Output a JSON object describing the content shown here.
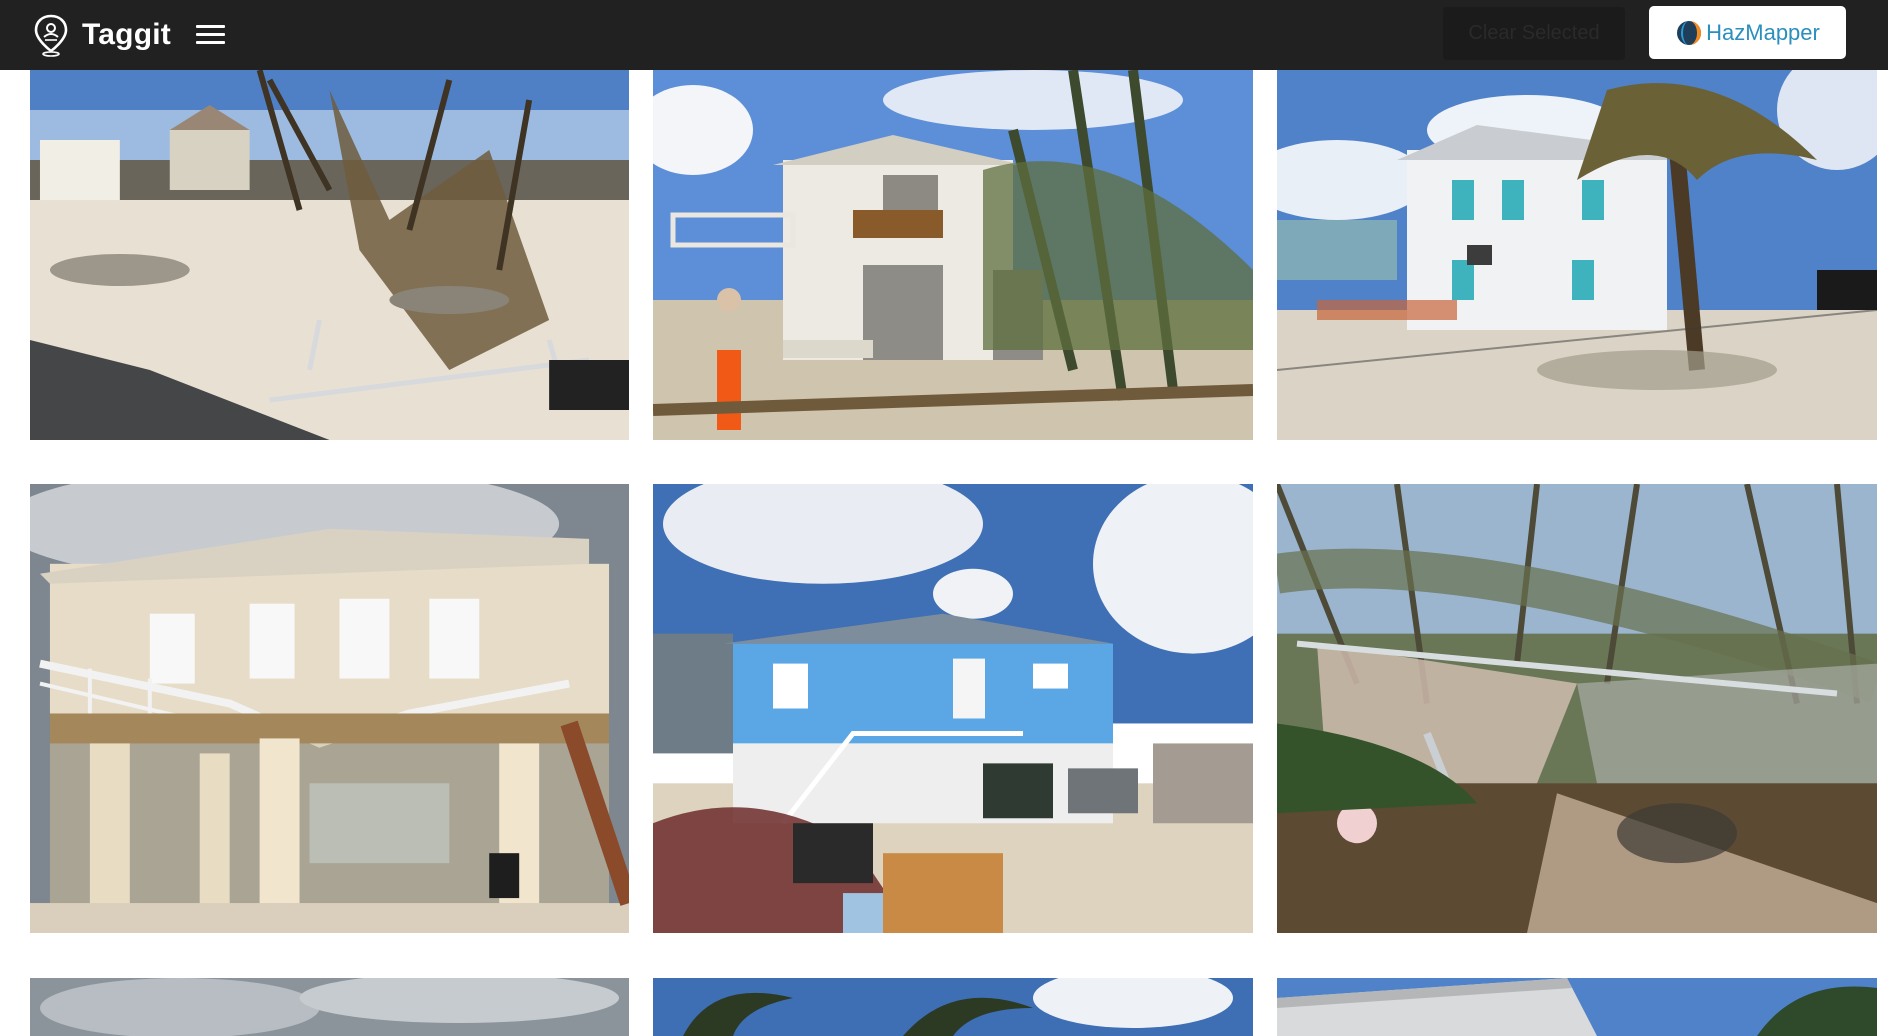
{
  "app": {
    "title": "Taggit",
    "logo_icon": "map-pin-icon",
    "menu_icon": "hamburger-menu-icon"
  },
  "toolbar": {
    "clear_selected_label": "Clear Selected",
    "hazmapper_label": "HazMapper",
    "hazmapper_icon": "hazmapper-logo-icon"
  },
  "colors": {
    "topbar": "#212121",
    "hazmapper_text": "#2b8fbd",
    "page_background": "#ffffff"
  },
  "gallery": {
    "columns": 3,
    "visible_rows": 3,
    "images": [
      {
        "name": "photo-1",
        "subject": "destroyed-houses-debris"
      },
      {
        "name": "photo-2",
        "subject": "white-two-story-house-palms"
      },
      {
        "name": "photo-3",
        "subject": "white-house-palm-tree"
      },
      {
        "name": "photo-4",
        "subject": "elevated-house-collapsed-railing"
      },
      {
        "name": "photo-5",
        "subject": "blue-stilt-house-cars"
      },
      {
        "name": "photo-6",
        "subject": "damaged-fence-vegetation"
      },
      {
        "name": "photo-7",
        "subject": "cloudy-sky-partial"
      },
      {
        "name": "photo-8",
        "subject": "palm-trees-partial"
      },
      {
        "name": "photo-9",
        "subject": "house-eave-partial"
      }
    ]
  }
}
